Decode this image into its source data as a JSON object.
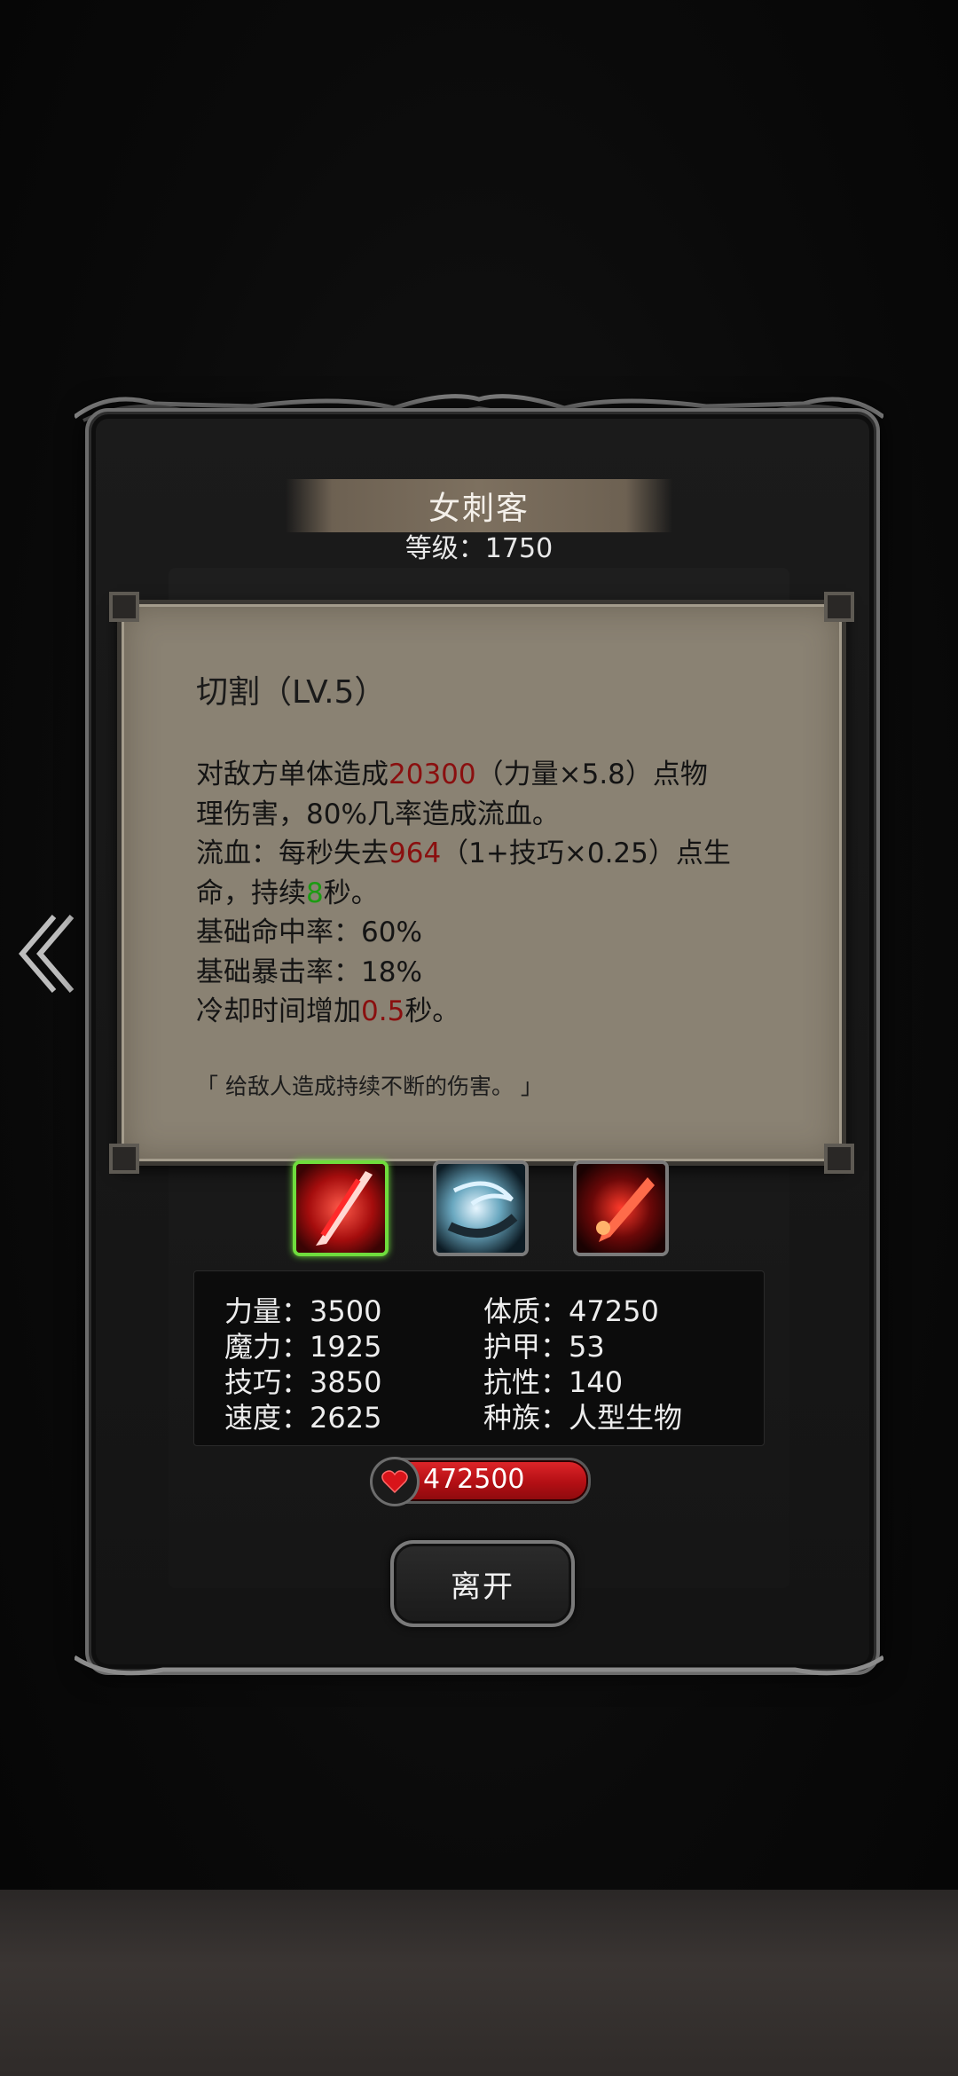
{
  "character": {
    "name": "女刺客",
    "level_label": "等级：1750"
  },
  "skill": {
    "title": "切割（LV.5）",
    "line1_a": "对敌方单体造成",
    "line1_val": "20300",
    "line1_b": "（力量×5.8）点物",
    "line2": "理伤害，80%几率造成流血。",
    "line3_a": "流血：每秒失去",
    "line3_val": "964",
    "line3_b": "（1+技巧×0.25）点生",
    "line4_a": "命，持续",
    "line4_val": "8",
    "line4_b": "秒。",
    "line5": "基础命中率：60%",
    "line6": "基础暴击率：18%",
    "line7_a": "冷却时间增加",
    "line7_val": "0.5",
    "line7_b": "秒。",
    "quote": "「 给敌人造成持续不断的伤害。 」"
  },
  "skill_icons": [
    {
      "name": "slash-skill-icon",
      "selected": true
    },
    {
      "name": "wind-slash-skill-icon",
      "selected": false
    },
    {
      "name": "blood-blade-skill-icon",
      "selected": false
    }
  ],
  "stats": {
    "strength": "力量：3500",
    "magic": "魔力：1925",
    "skill": "技巧：3850",
    "speed": "速度：2625",
    "constitution": "体质：47250",
    "armor": "护甲：53",
    "resistance": "抗性：140",
    "race": "种族：人型生物"
  },
  "hp": "472500",
  "leave_label": "离开",
  "colors": {
    "highlight_red": "#8a0f0f",
    "highlight_green": "#1c9b13",
    "selected_border": "#6fdc3d"
  }
}
